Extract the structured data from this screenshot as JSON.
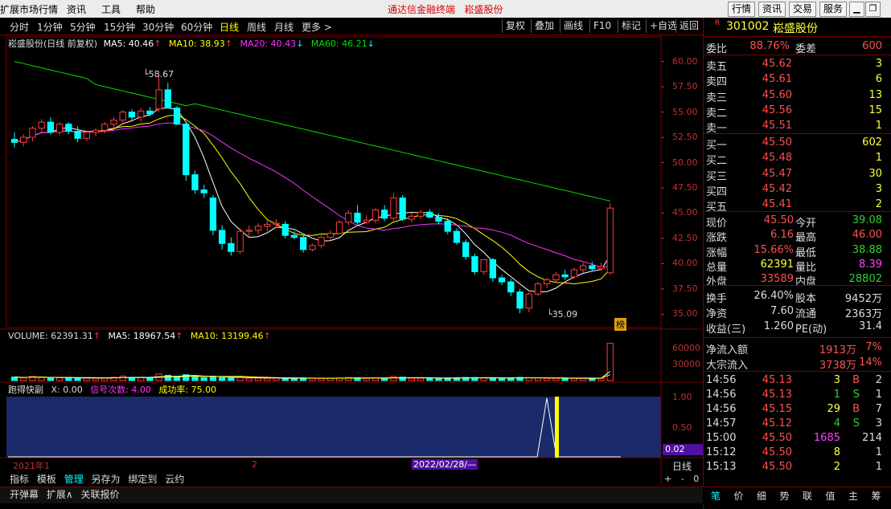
{
  "menu": {
    "items": [
      "扩展市场行情",
      "资讯",
      "工具",
      "帮助"
    ],
    "center_title": "通达信金融终端",
    "stock_title": "崧盛股份",
    "buttons": [
      "行情",
      "资讯",
      "交易",
      "服务"
    ]
  },
  "toolbar": {
    "periods": [
      "分时",
      "1分钟",
      "5分钟",
      "15分钟",
      "30分钟",
      "60分钟",
      "日线",
      "周线",
      "月线",
      "更多 >"
    ],
    "active": "日线",
    "right": [
      "复权",
      "叠加",
      "画线",
      "F10",
      "标记",
      "+自选",
      "返回"
    ]
  },
  "kline_legend": {
    "name": "崧盛股份(日线 前复权)",
    "ma5": "MA5: 40.46",
    "ma10": "MA10: 38.93",
    "ma20": "MA20: 40.43",
    "ma60": "MA60: 46.21"
  },
  "price_axis": [
    "60.00",
    "57.50",
    "55.00",
    "52.50",
    "50.00",
    "47.50",
    "45.00",
    "42.50",
    "40.00",
    "37.50",
    "35.00"
  ],
  "annotations": {
    "high": "58.67",
    "low": "35.09",
    "badge": "榜"
  },
  "volume_legend": {
    "vol": "VOLUME: 62391.31",
    "ma5": "MA5: 18967.54",
    "ma10": "MA10: 13199.46"
  },
  "volume_axis": [
    "60000",
    "30000"
  ],
  "indicator_legend": {
    "name": "跑得快副",
    "x": "X: 0.00",
    "sig": "信号次数: 4.00",
    "rate": "成功率: 75.00"
  },
  "indicator_axis": [
    "1.00",
    "0.50"
  ],
  "indicator_value": "0.02",
  "date_axis": {
    "left": "2021年1",
    "mid": "2",
    "cursor": "2022/02/28/—",
    "period": "日线"
  },
  "bottom_tabs1": [
    "指标",
    "模板",
    "管理",
    "另存为",
    "绑定到",
    "云约"
  ],
  "bottom_tabs2": [
    "开弹幕",
    "扩展∧",
    "关联报价"
  ],
  "zoom": [
    "+",
    "-",
    "0"
  ],
  "quote": {
    "code": "301002",
    "name": "崧盛股份",
    "flag": "R",
    "weibi_label": "委比",
    "weibi": "88.76%",
    "weicha_label": "委差",
    "weicha": "600",
    "sell": [
      {
        "l": "卖五",
        "p": "45.62",
        "v": "3"
      },
      {
        "l": "卖四",
        "p": "45.61",
        "v": "6"
      },
      {
        "l": "卖三",
        "p": "45.60",
        "v": "13"
      },
      {
        "l": "卖二",
        "p": "45.56",
        "v": "15"
      },
      {
        "l": "卖一",
        "p": "45.51",
        "v": "1"
      }
    ],
    "buy": [
      {
        "l": "买一",
        "p": "45.50",
        "v": "602"
      },
      {
        "l": "买二",
        "p": "45.48",
        "v": "1"
      },
      {
        "l": "买三",
        "p": "45.47",
        "v": "30"
      },
      {
        "l": "买四",
        "p": "45.42",
        "v": "3"
      },
      {
        "l": "买五",
        "p": "45.41",
        "v": "2"
      }
    ],
    "stats": [
      {
        "l1": "现价",
        "v1": "45.50",
        "c1": "#ff5050",
        "l2": "今开",
        "v2": "39.08",
        "c2": "#30d030"
      },
      {
        "l1": "涨跌",
        "v1": "6.16",
        "c1": "#ff5050",
        "l2": "最高",
        "v2": "46.00",
        "c2": "#ff5050"
      },
      {
        "l1": "涨幅",
        "v1": "15.66%",
        "c1": "#ff5050",
        "l2": "最低",
        "v2": "38.88",
        "c2": "#30d030"
      },
      {
        "l1": "总量",
        "v1": "62391",
        "c1": "#ffff40",
        "l2": "量比",
        "v2": "8.39",
        "c2": "#ff40ff"
      },
      {
        "l1": "外盘",
        "v1": "33589",
        "c1": "#ff5050",
        "l2": "内盘",
        "v2": "28802",
        "c2": "#30d030"
      }
    ],
    "stats2": [
      {
        "l1": "换手",
        "v1": "26.40%",
        "l2": "股本",
        "v2": "9452万"
      },
      {
        "l1": "净资",
        "v1": "7.60",
        "l2": "流通",
        "v2": "2363万"
      },
      {
        "l1": "收益(三)",
        "v1": "1.260",
        "l2": "PE(动)",
        "v2": "31.4"
      }
    ],
    "flow": [
      {
        "l": "净流入额",
        "v": "1913万",
        "p": "7%"
      },
      {
        "l": "大宗流入",
        "v": "3738万",
        "p": "14%"
      }
    ],
    "ticks": [
      {
        "t": "14:56",
        "p": "45.13",
        "v": "3",
        "d": "B",
        "n": "2"
      },
      {
        "t": "14:56",
        "p": "45.13",
        "v": "1",
        "d": "S",
        "n": "1"
      },
      {
        "t": "14:56",
        "p": "45.15",
        "v": "29",
        "d": "B",
        "n": "7"
      },
      {
        "t": "14:57",
        "p": "45.12",
        "v": "4",
        "d": "S",
        "n": "3"
      },
      {
        "t": "15:00",
        "p": "45.50",
        "v": "1685",
        "d": "",
        "n": "214"
      },
      {
        "t": "15:12",
        "p": "45.50",
        "v": "8",
        "d": "",
        "n": "1"
      },
      {
        "t": "15:13",
        "p": "45.50",
        "v": "2",
        "d": "",
        "n": "1"
      }
    ],
    "tabs": [
      "笔",
      "价",
      "细",
      "势",
      "联",
      "值",
      "主",
      "筹"
    ]
  },
  "chart_data": {
    "type": "candlestick",
    "ohlc": [
      [
        52.3,
        53.0,
        51.5,
        52.0
      ],
      [
        52.0,
        52.8,
        51.6,
        52.5
      ],
      [
        52.5,
        53.6,
        52.1,
        53.4
      ],
      [
        53.4,
        54.3,
        53.0,
        54.0
      ],
      [
        54.0,
        54.5,
        52.8,
        53.0
      ],
      [
        53.0,
        54.0,
        52.7,
        53.8
      ],
      [
        53.8,
        54.0,
        52.8,
        53.1
      ],
      [
        53.1,
        53.6,
        52.0,
        52.4
      ],
      [
        52.4,
        53.2,
        52.1,
        53.0
      ],
      [
        53.0,
        53.4,
        52.6,
        53.2
      ],
      [
        53.2,
        54.0,
        52.9,
        53.8
      ],
      [
        53.8,
        54.5,
        53.3,
        54.2
      ],
      [
        54.2,
        55.2,
        53.8,
        55.0
      ],
      [
        55.0,
        55.3,
        54.2,
        54.5
      ],
      [
        54.5,
        55.4,
        54.0,
        55.1
      ],
      [
        55.1,
        55.5,
        54.6,
        54.8
      ],
      [
        55.3,
        58.7,
        55.0,
        57.2
      ],
      [
        57.2,
        57.9,
        55.4,
        55.4
      ],
      [
        55.4,
        55.6,
        53.7,
        53.8
      ],
      [
        53.8,
        54.0,
        48.2,
        48.8
      ],
      [
        48.8,
        49.2,
        46.9,
        47.3
      ],
      [
        47.3,
        47.8,
        46.5,
        47.0
      ],
      [
        46.5,
        46.8,
        42.8,
        43.3
      ],
      [
        43.3,
        43.8,
        41.4,
        42.0
      ],
      [
        42.0,
        42.6,
        40.8,
        41.2
      ],
      [
        41.2,
        43.5,
        41.0,
        43.2
      ],
      [
        43.2,
        43.8,
        42.7,
        43.3
      ],
      [
        43.3,
        44.0,
        42.9,
        43.7
      ],
      [
        43.7,
        44.3,
        43.2,
        43.9
      ],
      [
        43.9,
        44.4,
        43.5,
        44.0
      ],
      [
        43.9,
        44.2,
        42.5,
        42.8
      ],
      [
        42.8,
        43.2,
        42.4,
        42.6
      ],
      [
        42.6,
        42.8,
        41.1,
        41.4
      ],
      [
        41.4,
        42.0,
        41.2,
        41.8
      ],
      [
        41.8,
        42.8,
        41.5,
        42.6
      ],
      [
        42.6,
        43.3,
        42.3,
        43.0
      ],
      [
        43.0,
        44.3,
        42.9,
        44.1
      ],
      [
        44.1,
        45.3,
        43.8,
        45.0
      ],
      [
        45.0,
        45.8,
        43.8,
        44.1
      ],
      [
        44.1,
        44.8,
        43.9,
        44.3
      ],
      [
        44.3,
        45.5,
        44.0,
        45.3
      ],
      [
        45.3,
        45.8,
        44.2,
        44.5
      ],
      [
        44.5,
        47.0,
        44.2,
        46.5
      ],
      [
        46.5,
        46.8,
        44.2,
        44.4
      ],
      [
        44.4,
        45.0,
        44.1,
        44.7
      ],
      [
        44.7,
        45.3,
        44.4,
        45.1
      ],
      [
        45.1,
        45.4,
        44.5,
        44.6
      ],
      [
        44.6,
        45.0,
        43.9,
        44.2
      ],
      [
        44.2,
        44.5,
        42.9,
        43.2
      ],
      [
        43.2,
        43.5,
        41.9,
        42.1
      ],
      [
        42.1,
        42.4,
        40.4,
        40.7
      ],
      [
        40.7,
        41.0,
        38.9,
        39.2
      ],
      [
        39.2,
        39.5,
        38.9,
        40.4
      ],
      [
        40.4,
        40.6,
        38.2,
        38.6
      ],
      [
        38.6,
        38.9,
        37.9,
        38.2
      ],
      [
        38.2,
        38.5,
        36.8,
        37.2
      ],
      [
        37.2,
        37.5,
        35.1,
        35.6
      ],
      [
        35.6,
        37.2,
        35.2,
        37.0
      ],
      [
        37.0,
        38.2,
        36.8,
        38.0
      ],
      [
        38.0,
        38.6,
        37.6,
        38.4
      ],
      [
        38.4,
        39.2,
        38.1,
        38.9
      ],
      [
        38.9,
        39.4,
        38.4,
        38.7
      ],
      [
        38.7,
        39.6,
        38.5,
        39.4
      ],
      [
        39.4,
        40.1,
        39.1,
        39.8
      ],
      [
        39.8,
        40.2,
        39.2,
        39.5
      ],
      [
        39.5,
        40.1,
        39.3,
        39.7
      ],
      [
        39.1,
        46.0,
        38.9,
        45.5
      ]
    ],
    "volume": [
      6000,
      4500,
      7000,
      5200,
      4000,
      4800,
      5000,
      3900,
      4200,
      3800,
      4100,
      5500,
      7600,
      5200,
      4800,
      3900,
      11000,
      8800,
      7200,
      9800,
      6200,
      4800,
      7000,
      5100,
      4200,
      5600,
      3900,
      4100,
      3800,
      3900,
      4200,
      3600,
      4500,
      3800,
      3500,
      3900,
      4300,
      5200,
      4800,
      3700,
      4100,
      3900,
      6900,
      5600,
      3900,
      3800,
      3700,
      4000,
      4300,
      4800,
      5200,
      5100,
      4600,
      4200,
      4100,
      4400,
      5300,
      4900,
      4200,
      3800,
      3700,
      4100,
      3600,
      3900,
      3700,
      3800,
      62391
    ],
    "ma_series": [
      "MA5",
      "MA10",
      "MA20",
      "MA60"
    ],
    "price_range": [
      34.0,
      61.0
    ],
    "volume_range": [
      0,
      70000
    ],
    "indicator_spike": [
      0,
      0,
      1,
      0
    ]
  },
  "colors": {
    "up": "#ff3c3c",
    "down": "#00ffff",
    "ma5": "#ffffff",
    "ma10": "#ffff00",
    "ma20": "#ff30ff",
    "ma60": "#00e000",
    "grid": "#7a0000",
    "axis": "#c03030"
  }
}
